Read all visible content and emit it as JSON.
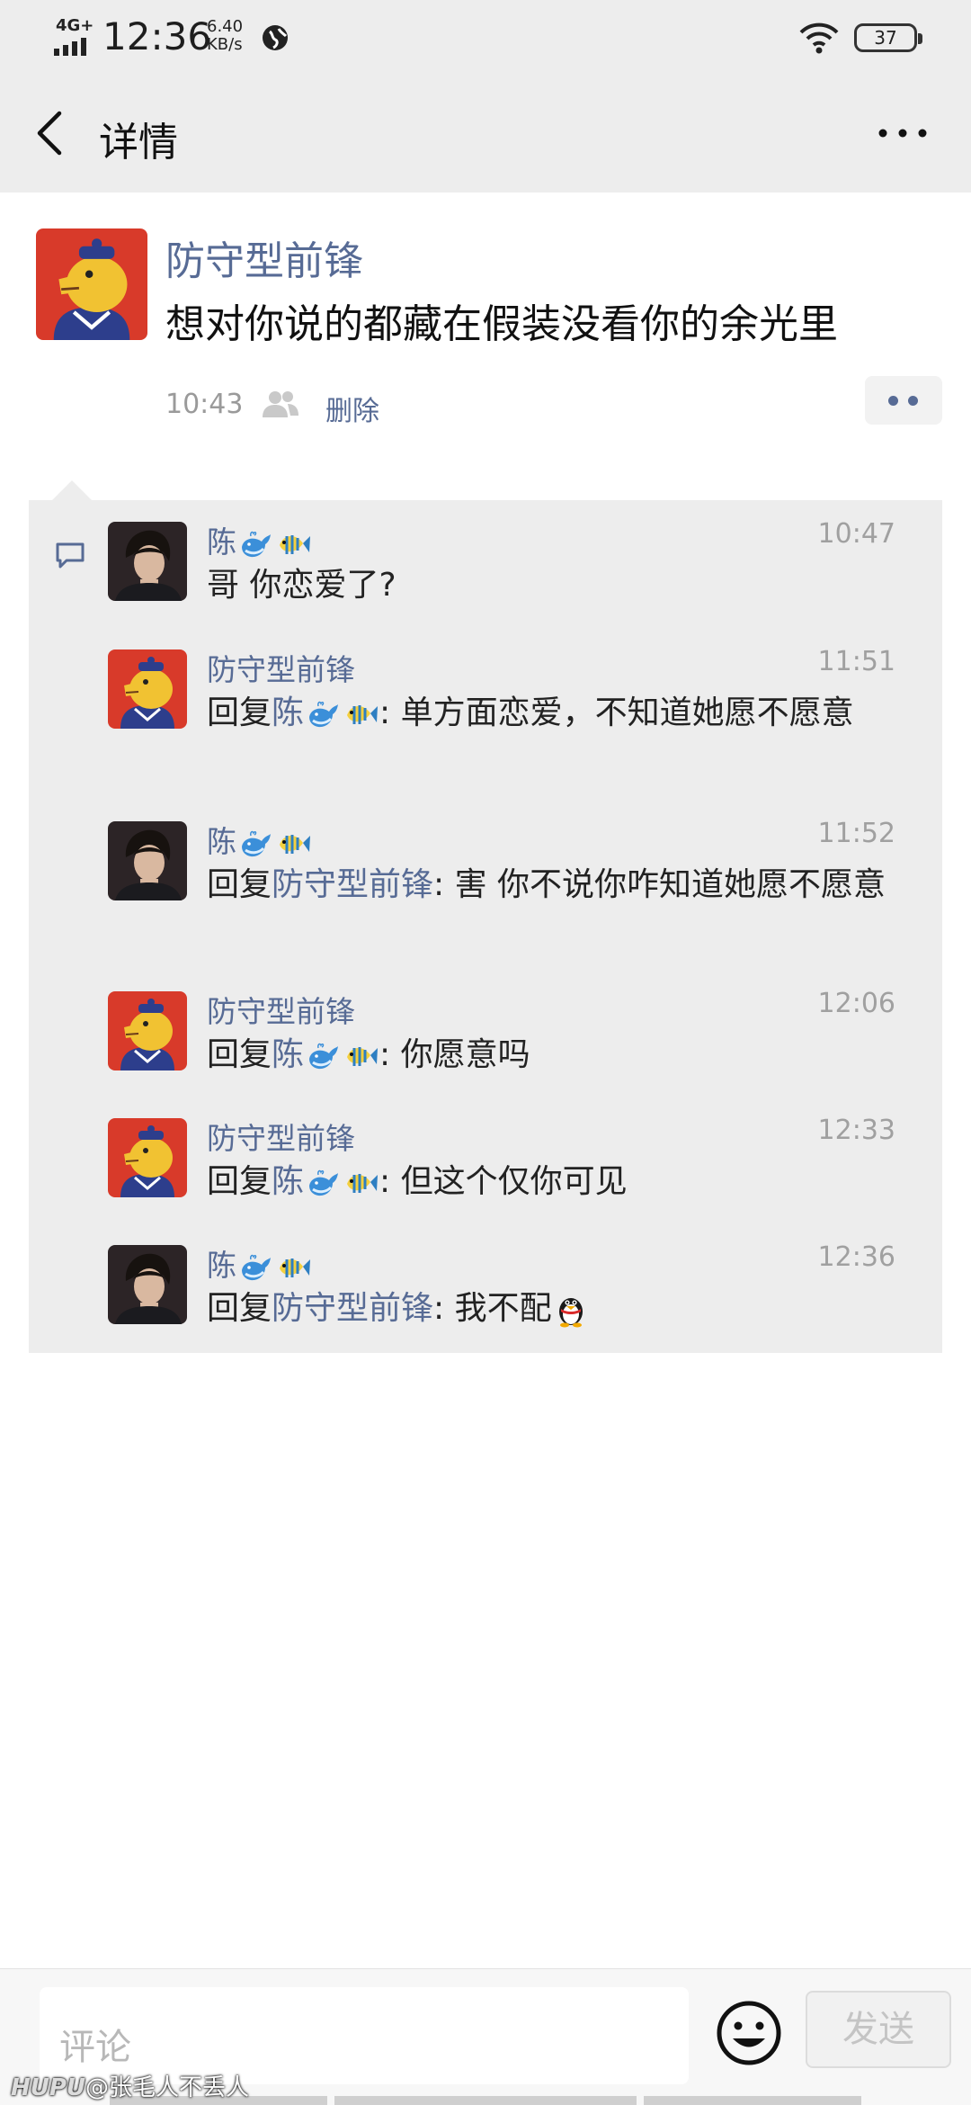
{
  "status_bar": {
    "network": "4G+",
    "time": "12:36",
    "speed_value": "6.40",
    "speed_unit": "KB/s",
    "battery": "37"
  },
  "nav": {
    "title": "详情"
  },
  "post": {
    "author": "防守型前锋",
    "text": "想对你说的都藏在假装没看你的余光里",
    "time": "10:43",
    "delete_label": "删除"
  },
  "comments": [
    {
      "avatar": "boy-avatar",
      "name": "陈",
      "time": "10:47",
      "reply_prefix": "",
      "reply_to": "",
      "reply_to_emoji": false,
      "text": "哥 你恋爱了?"
    },
    {
      "avatar": "yellow-avatar",
      "name": "防守型前锋",
      "time": "11:51",
      "reply_prefix": "回复",
      "reply_to": "陈",
      "reply_to_emoji": true,
      "text": ": 单方面恋爱，不知道她愿不愿意"
    },
    {
      "avatar": "boy-avatar",
      "name": "陈",
      "time": "11:52",
      "reply_prefix": "回复",
      "reply_to": "防守型前锋",
      "reply_to_emoji": false,
      "text": ": 害 你不说你咋知道她愿不愿意"
    },
    {
      "avatar": "yellow-avatar",
      "name": "防守型前锋",
      "time": "12:06",
      "reply_prefix": "回复",
      "reply_to": "陈",
      "reply_to_emoji": true,
      "text": ": 你愿意吗"
    },
    {
      "avatar": "yellow-avatar",
      "name": "防守型前锋",
      "time": "12:33",
      "reply_prefix": "回复",
      "reply_to": "陈",
      "reply_to_emoji": true,
      "text": ": 但这个仅你可见"
    },
    {
      "avatar": "boy-avatar",
      "name": "陈",
      "time": "12:36",
      "reply_prefix": "回复",
      "reply_to": "防守型前锋",
      "reply_to_emoji": false,
      "text": ": 我不配"
    }
  ],
  "input": {
    "placeholder": "评论",
    "send_label": "发送"
  },
  "watermark": {
    "brand": "HUPU",
    "user": "@张毛人不丢人"
  },
  "icons": [
    "back-arrow-icon",
    "more-icon",
    "visibility-icon",
    "comment-icon",
    "whale-emoji",
    "fish-emoji",
    "penguin-emoji",
    "smiley-icon"
  ],
  "colors": {
    "link": "#576b95",
    "header_bg": "#ededed",
    "comment_bg": "#ededed"
  }
}
